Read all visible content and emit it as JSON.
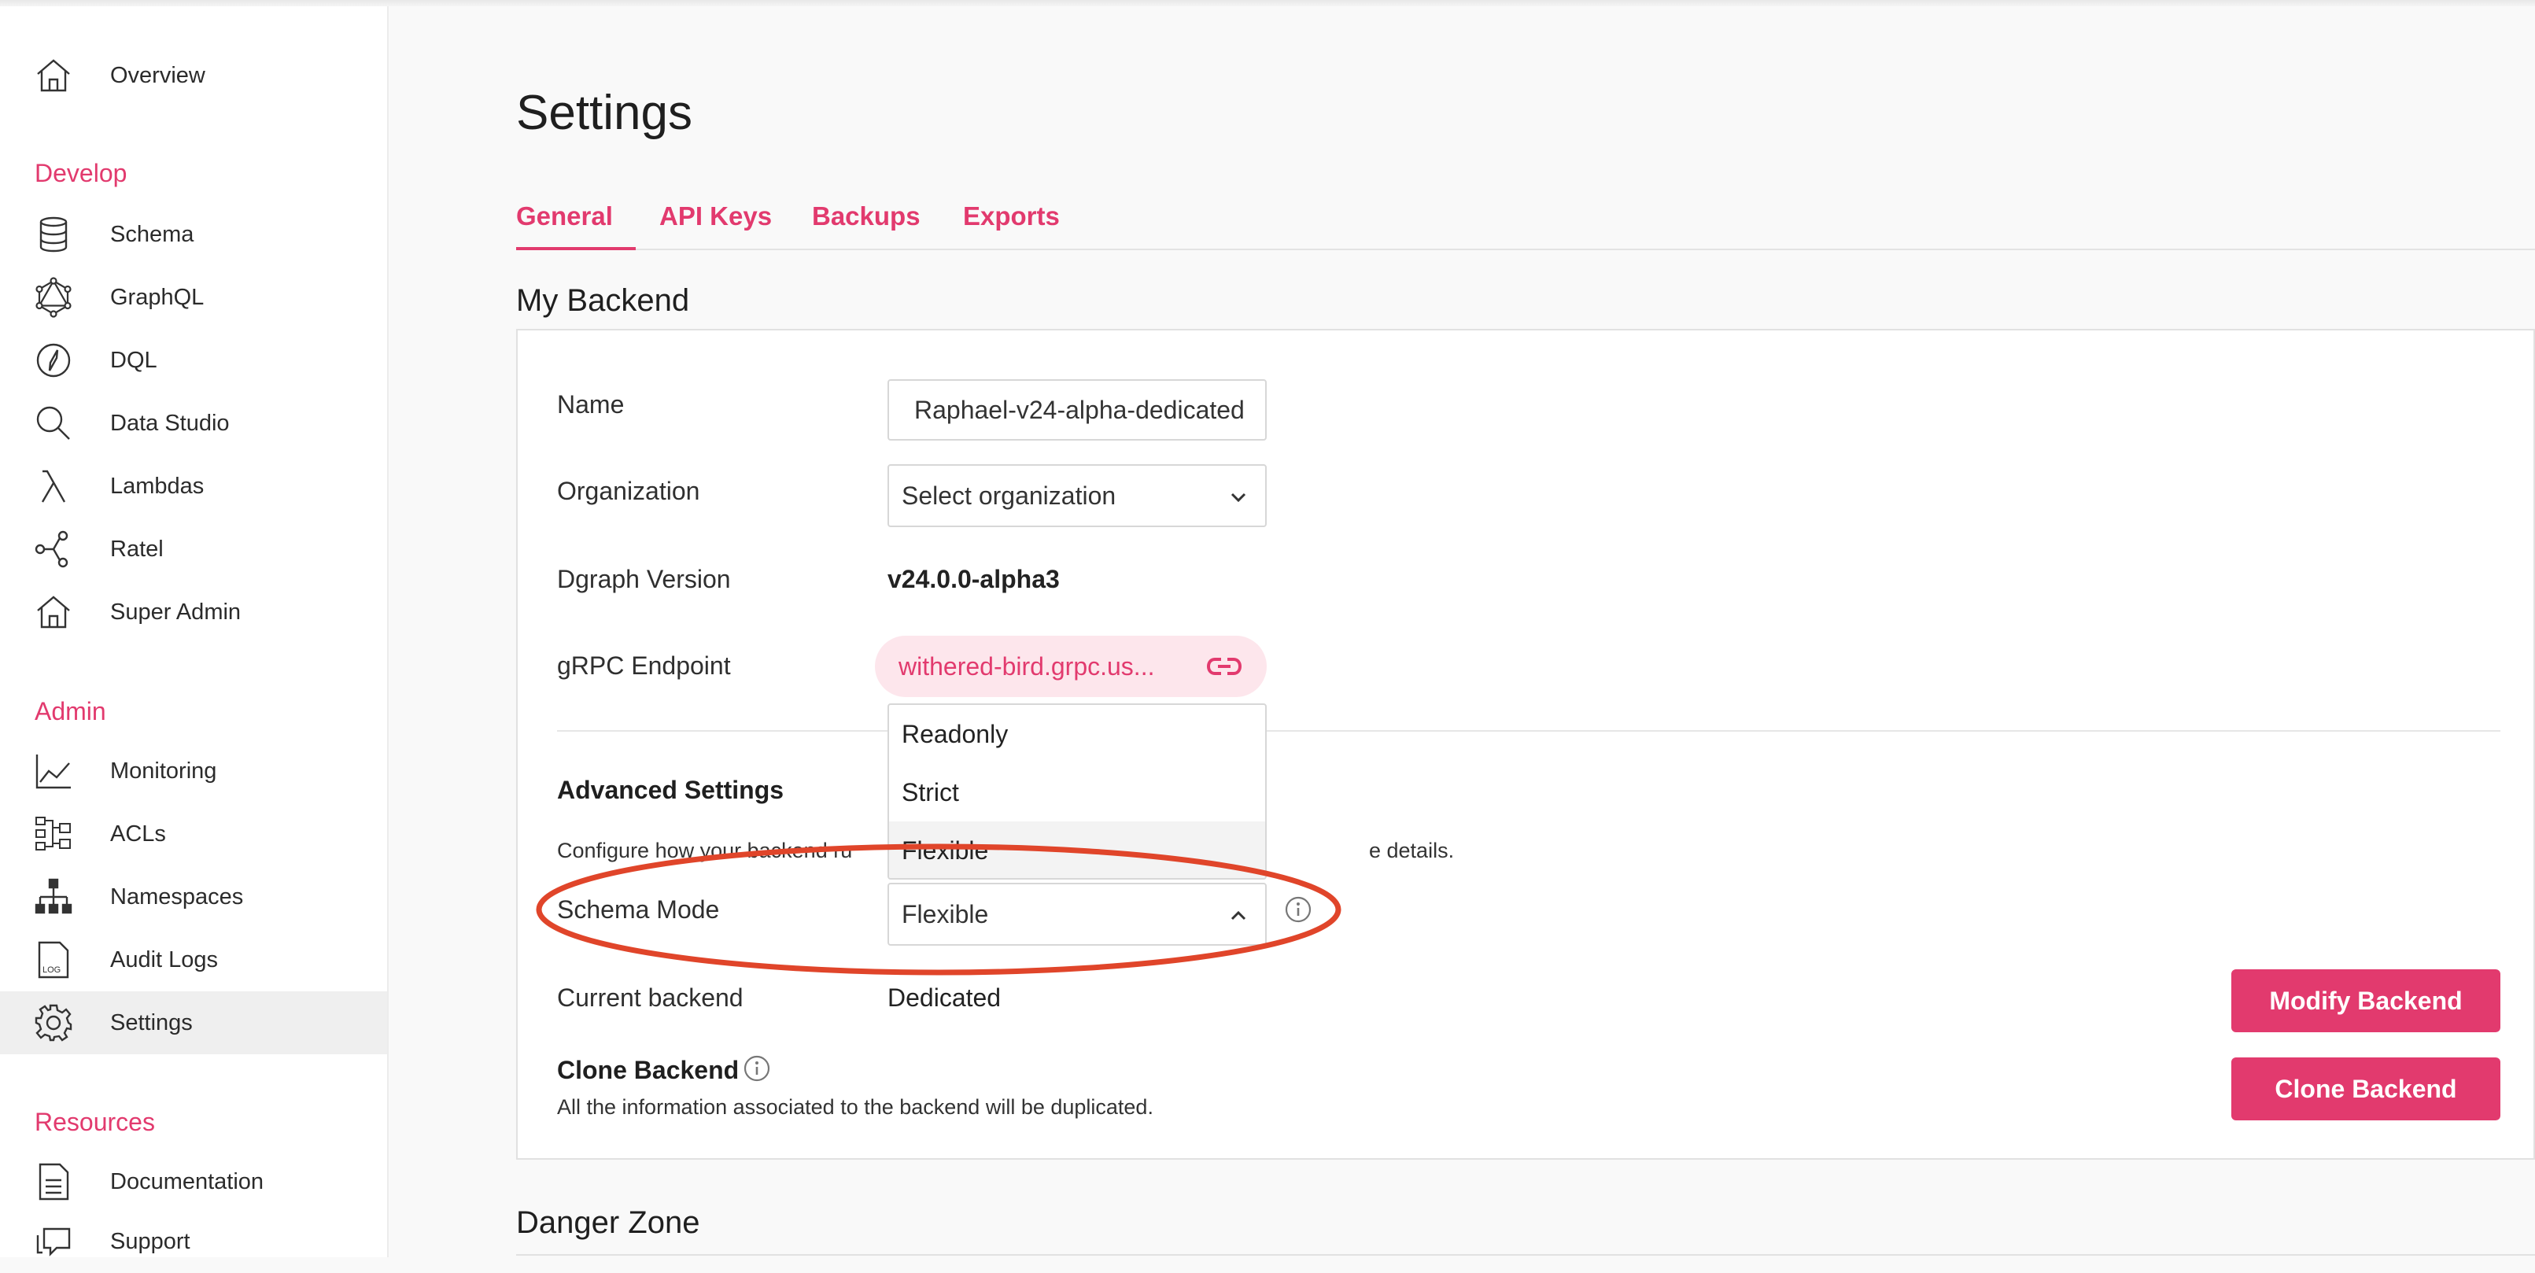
{
  "sidebar": {
    "top_items": [
      {
        "label": "Overview",
        "icon": "home-icon"
      }
    ],
    "sections": [
      {
        "title": "Develop",
        "items": [
          {
            "label": "Schema",
            "icon": "database-icon"
          },
          {
            "label": "GraphQL",
            "icon": "graphql-icon"
          },
          {
            "label": "DQL",
            "icon": "compass-icon"
          },
          {
            "label": "Data Studio",
            "icon": "search-icon"
          },
          {
            "label": "Lambdas",
            "icon": "lambda-icon"
          },
          {
            "label": "Ratel",
            "icon": "nodes-icon"
          },
          {
            "label": "Super Admin",
            "icon": "home-icon"
          }
        ]
      },
      {
        "title": "Admin",
        "items": [
          {
            "label": "Monitoring",
            "icon": "line-chart-icon"
          },
          {
            "label": "ACLs",
            "icon": "acl-icon"
          },
          {
            "label": "Namespaces",
            "icon": "hierarchy-icon"
          },
          {
            "label": "Audit Logs",
            "icon": "log-file-icon"
          },
          {
            "label": "Settings",
            "icon": "gear-icon"
          }
        ]
      },
      {
        "title": "Resources",
        "items": [
          {
            "label": "Documentation",
            "icon": "document-icon"
          },
          {
            "label": "Support",
            "icon": "chat-icon"
          }
        ]
      }
    ],
    "log_icon_text": "LOG"
  },
  "page": {
    "title": "Settings",
    "tabs": [
      "General",
      "API Keys",
      "Backups",
      "Exports"
    ],
    "section_title": "My Backend",
    "danger_title": "Danger Zone"
  },
  "form": {
    "name_label": "Name",
    "name_value": "Raphael-v24-alpha-dedicated",
    "org_label": "Organization",
    "org_value": "Select organization",
    "version_label": "Dgraph Version",
    "version_value": "v24.0.0-alpha3",
    "grpc_label": "gRPC Endpoint",
    "grpc_value": "withered-bird.grpc.us...",
    "advanced_title": "Advanced Settings",
    "advanced_desc_start": "Configure how your backend ru",
    "advanced_desc_end": "e details.",
    "schema_mode_label": "Schema Mode",
    "schema_mode_value": "Flexible",
    "schema_mode_options": [
      "Readonly",
      "Strict",
      "Flexible"
    ],
    "current_backend_label": "Current backend",
    "current_backend_value": "Dedicated",
    "clone_title": "Clone Backend",
    "clone_desc": "All the information associated to the backend will be duplicated.",
    "modify_button": "Modify Backend",
    "clone_button": "Clone Backend"
  },
  "colors": {
    "accent": "#e23a6e",
    "annotation": "#e0452a"
  }
}
